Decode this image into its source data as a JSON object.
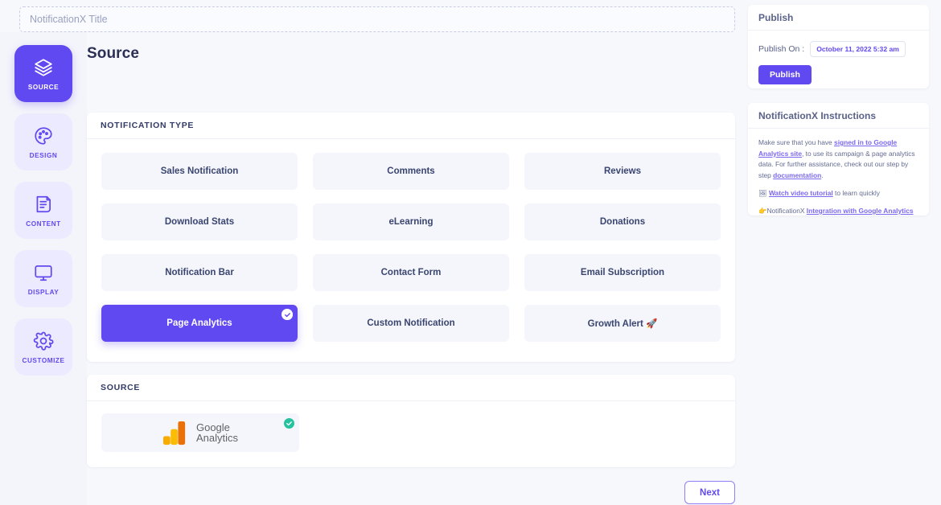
{
  "title_input": {
    "value": "",
    "placeholder": "NotificationX Title"
  },
  "page": {
    "heading": "Source"
  },
  "stepper": {
    "items": [
      {
        "label": "SOURCE",
        "icon": "layers-icon",
        "active": true
      },
      {
        "label": "DESIGN",
        "icon": "palette-icon",
        "active": false
      },
      {
        "label": "CONTENT",
        "icon": "document-icon",
        "active": false
      },
      {
        "label": "DISPLAY",
        "icon": "monitor-icon",
        "active": false
      },
      {
        "label": "CUSTOMIZE",
        "icon": "gear-icon",
        "active": false
      }
    ]
  },
  "notification_type": {
    "section_title": "NOTIFICATION TYPE",
    "tiles": [
      {
        "label": "Sales Notification",
        "selected": false
      },
      {
        "label": "Comments",
        "selected": false
      },
      {
        "label": "Reviews",
        "selected": false
      },
      {
        "label": "Download Stats",
        "selected": false
      },
      {
        "label": "eLearning",
        "selected": false
      },
      {
        "label": "Donations",
        "selected": false
      },
      {
        "label": "Notification Bar",
        "selected": false
      },
      {
        "label": "Contact Form",
        "selected": false
      },
      {
        "label": "Email Subscription",
        "selected": false
      },
      {
        "label": "Page Analytics",
        "selected": true
      },
      {
        "label": "Custom Notification",
        "selected": false
      },
      {
        "label": "Growth Alert 🚀",
        "selected": false
      }
    ]
  },
  "source": {
    "section_title": "SOURCE",
    "items": [
      {
        "name": "Google",
        "name2": "Analytics",
        "selected": true
      }
    ]
  },
  "footer": {
    "next_label": "Next"
  },
  "publish": {
    "title": "Publish",
    "publish_on_label": "Publish On :",
    "publish_on_value": "October 11, 2022 5:32 am",
    "button_label": "Publish"
  },
  "instructions": {
    "title": "NotificationX Instructions",
    "paragraph_1": "Make sure that you have ",
    "link_1": "signed in to Google Analytics site",
    "paragraph_2": ", to use its campaign & page analytics data. For further assistance, check out our step by step ",
    "link_2": "documentation",
    "paragraph_3": ".",
    "video_emoji": "🖼",
    "video_link": "Watch video tutorial",
    "video_suffix": " to learn quickly",
    "integration_emoji": "👉",
    "integration_prefix": "NotificationX ",
    "integration_link": "Integration with Google Analytics"
  },
  "colors": {
    "accent": "#6049f0",
    "accent_soft": "#eceaff",
    "page_bg": "#f7f8fc",
    "tile_bg": "#f4f6fb",
    "check_teal": "#25c2a0",
    "text_dark": "#2b2f55"
  }
}
